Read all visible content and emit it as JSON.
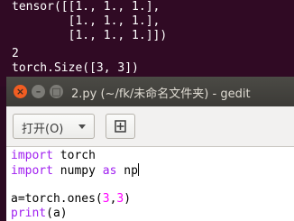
{
  "terminal": {
    "lines": [
      "tensor([[1., 1., 1.],",
      "        [1., 1., 1.],",
      "        [1., 1., 1.]])",
      "2",
      "torch.Size([3, 3])"
    ]
  },
  "window": {
    "title": "2.py (~/fk/未命名文件夹) - gedit",
    "close_glyph": "×",
    "min_glyph": "–",
    "max_glyph": "□"
  },
  "toolbar": {
    "open_label": "打开(O)"
  },
  "editor": {
    "line1": {
      "kw": "import",
      "rest": " torch"
    },
    "line2": {
      "kw": "import",
      "mid": " numpy ",
      "kw2": "as",
      "rest": " np"
    },
    "line4": {
      "pre": "a=torch.ones(",
      "n1": "3",
      "comma": ",",
      "n2": "3",
      "post": ")"
    },
    "line5": {
      "fn": "print",
      "rest": "(a)"
    }
  },
  "colors": {
    "terminal_bg": "#300a24",
    "keyword": "#a020f0",
    "number": "#ff00ff",
    "close_button": "#f15d22"
  }
}
